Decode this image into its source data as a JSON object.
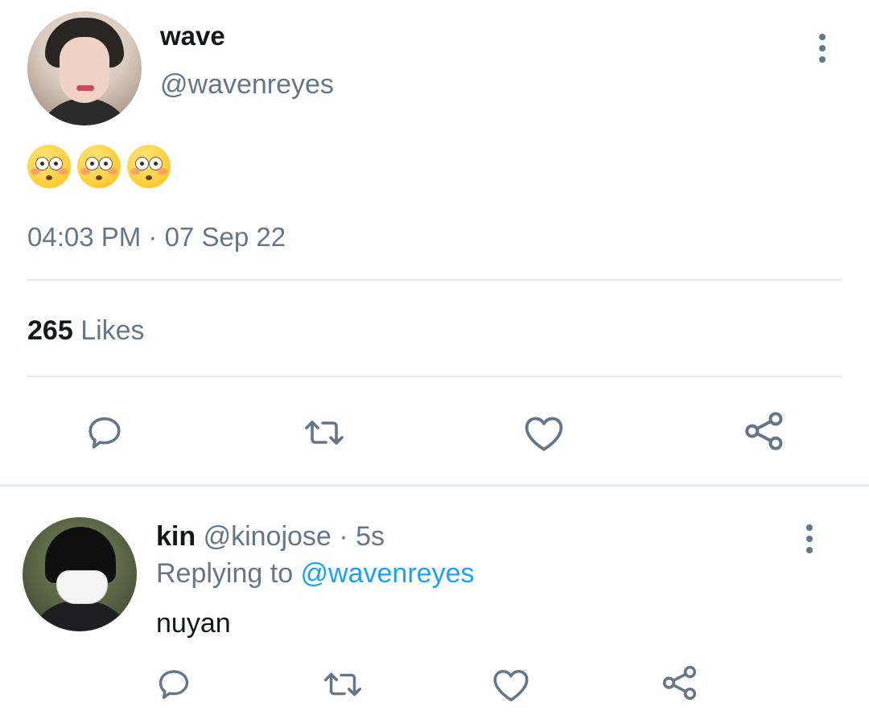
{
  "tweet": {
    "display_name": "wave",
    "handle": "@wavenreyes",
    "emoji_text": "😳😳😳",
    "timestamp": "04:03 PM · 07 Sep 22",
    "likes_count": "265",
    "likes_label": "Likes"
  },
  "reply": {
    "display_name": "kin",
    "handle": "@kinojose",
    "time_sep": " · ",
    "time_ago": "5s",
    "replying_prefix": "Replying to ",
    "replying_handle": "@wavenreyes",
    "text": "nuyan"
  },
  "icons": {
    "reply": "reply-bubble-icon",
    "retweet": "retweet-icon",
    "like": "heart-icon",
    "share": "share-icon",
    "more": "more-vertical-icon"
  },
  "colors": {
    "icon_gray": "#657786",
    "text_primary": "#14171a",
    "link_blue": "#1da1f2",
    "divider": "#e6ecf0"
  }
}
